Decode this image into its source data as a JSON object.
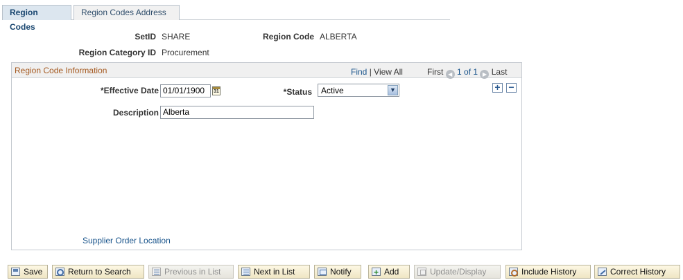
{
  "tabs": [
    {
      "label": "Region Codes",
      "active": true
    },
    {
      "label": "Region Codes Address",
      "active": false
    }
  ],
  "header": {
    "setid_label": "SetID",
    "setid_value": "SHARE",
    "region_code_label": "Region Code",
    "region_code_value": "ALBERTA",
    "region_category_label": "Region Category ID",
    "region_category_value": "Procurement"
  },
  "group": {
    "title": "Region Code Information",
    "find": "Find",
    "separator": "|",
    "view_all": "View All",
    "first": "First",
    "page_indicator": "1 of 1",
    "last": "Last",
    "effective_date_label": "*Effective Date",
    "effective_date_value": "01/01/1900",
    "status_label": "*Status",
    "status_value": "Active",
    "description_label": "Description",
    "description_value": "Alberta",
    "supplier_link": "Supplier Order Location"
  },
  "toolbar": {
    "save": "Save",
    "return_to_search": "Return to Search",
    "previous_in_list": "Previous in List",
    "next_in_list": "Next in List",
    "notify": "Notify",
    "add": "Add",
    "update_display": "Update/Display",
    "include_history": "Include History",
    "correct_history": "Correct History"
  }
}
